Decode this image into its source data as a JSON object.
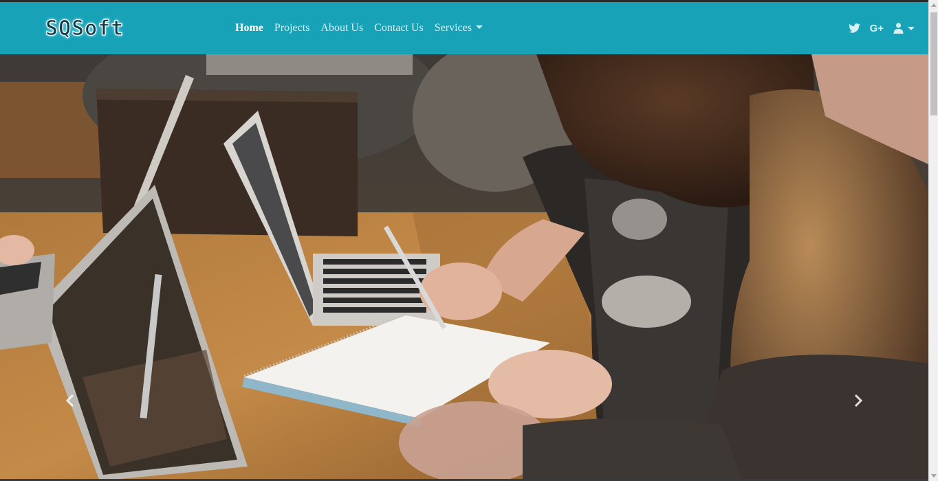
{
  "brand": {
    "name": "SQSoft"
  },
  "nav": {
    "items": [
      {
        "label": "Home",
        "active": true
      },
      {
        "label": "Projects",
        "active": false
      },
      {
        "label": "About Us",
        "active": false
      },
      {
        "label": "Contact Us",
        "active": false
      },
      {
        "label": "Services",
        "active": false,
        "dropdown": true
      }
    ]
  },
  "nav_right": {
    "twitter_icon": "twitter-icon",
    "google_plus_label": "G+",
    "user_icon": "user-icon"
  },
  "hero": {
    "icons": {
      "prev": "chevron-left-icon",
      "next": "chevron-right-icon"
    }
  },
  "colors": {
    "navbar": "#17a2b8",
    "nav_text": "#d6f0f4",
    "nav_active": "#ffffff"
  }
}
